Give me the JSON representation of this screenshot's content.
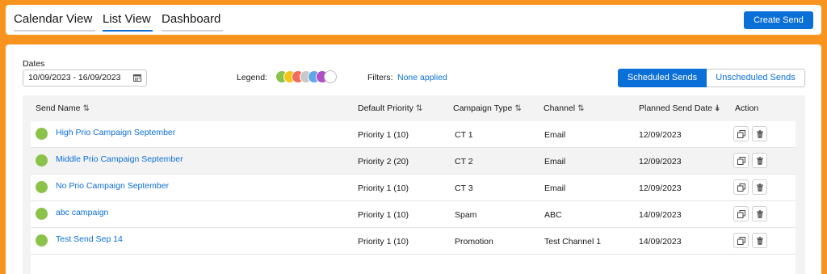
{
  "nav": {
    "tabs": [
      {
        "label": "Calendar View",
        "active": false
      },
      {
        "label": "List View",
        "active": true
      },
      {
        "label": "Dashboard",
        "active": false
      }
    ],
    "create_button": "Create Send"
  },
  "toolbar": {
    "dates_label": "Dates",
    "date_range": "10/09/2023 - 16/09/2023",
    "legend_label": "Legend:",
    "legend_colors": [
      "#8bc34a",
      "#f5c518",
      "#f26b5b",
      "#c8c8c8",
      "#5fa8e8",
      "#b04fc7",
      "#ffffff"
    ],
    "filters_label": "Filters:",
    "filters_value": "None applied",
    "scheduled_label": "Scheduled Sends",
    "unscheduled_label": "Unscheduled Sends"
  },
  "table": {
    "headers": {
      "send_name": "Send Name",
      "priority": "Default Priority",
      "campaign_type": "Campaign Type",
      "channel": "Channel",
      "planned_date": "Planned Send Date",
      "action": "Action"
    },
    "rows": [
      {
        "name": "High Prio Campaign September",
        "priority": "Priority 1 (10)",
        "campaign_type": "CT 1",
        "channel": "Email",
        "date": "12/09/2023",
        "status_color": "#8bc34a"
      },
      {
        "name": "Middle Prio Campaign September",
        "priority": "Priority 2 (20)",
        "campaign_type": "CT 2",
        "channel": "Email",
        "date": "12/09/2023",
        "status_color": "#8bc34a"
      },
      {
        "name": "No Prio Campaign September",
        "priority": "Priority 1 (10)",
        "campaign_type": "CT 3",
        "channel": "Email",
        "date": "12/09/2023",
        "status_color": "#8bc34a"
      },
      {
        "name": "abc campaign",
        "priority": "Priority 1 (10)",
        "campaign_type": "Spam",
        "channel": "ABC",
        "date": "14/09/2023",
        "status_color": "#8bc34a"
      },
      {
        "name": "Test Send Sep 14",
        "priority": "Priority 1 (10)",
        "campaign_type": "Promotion",
        "channel": "Test Channel 1",
        "date": "14/09/2023",
        "status_color": "#8bc34a"
      }
    ]
  }
}
